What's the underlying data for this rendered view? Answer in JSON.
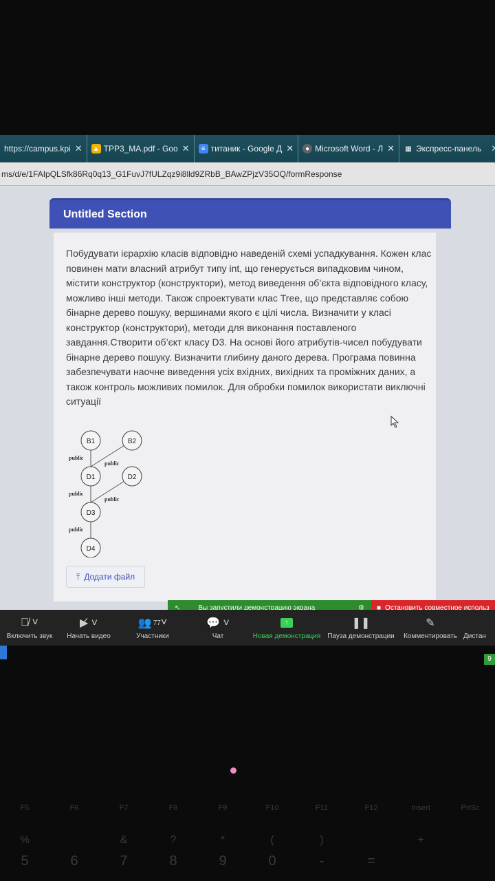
{
  "browser": {
    "tabs": [
      {
        "label": "https://campus.kpi",
        "icon": "site-icon"
      },
      {
        "label": "TPP3_MA.pdf - Goo",
        "icon": "google-drive-icon"
      },
      {
        "label": "титаник - Google Д",
        "icon": "google-docs-icon"
      },
      {
        "label": "Microsoft Word - Л",
        "icon": "chrome-icon"
      },
      {
        "label": "Экспресс-панель",
        "icon": "grid-icon"
      }
    ],
    "url": "ms/d/e/1FAIpQLSfk86Rq0q13_G1FuvJ7fULZqz9i8lld9ZRbB_BAwZPjzV35OQ/formResponse"
  },
  "form": {
    "section_title": "Untitled Section",
    "task_text": "Побудувати ієрархію класів відповідно наведеній схемі успадкування. Кожен клас повинен мати власний атрибут типу int, що генерується випадковим чином, містити конструктор (конструктори), метод виведення об’єкта відповідного класу, можливо інші методи. Також спроектувати клас Tree, що представляє собою бінарне дерево пошуку, вершинами якого є цілі числа. Визначити у класі конструктор (конструктори), методи для виконання поставленого завдання.Створити об’єкт класу D3. На основі його атрибутів-чисел побудувати бінарне дерево пошуку. Визначити глибину даного дерева. Програма повинна забезпечувати наочне виведення усіх вхідних, вихідних та проміжних даних, а також контроль можливих помилок. Для обробки помилок використати виключні ситуації",
    "diagram": {
      "nodes": [
        "B1",
        "B2",
        "D1",
        "D2",
        "D3",
        "D4"
      ],
      "edge_label": "public"
    },
    "add_file_label": "Додати файл"
  },
  "zoom": {
    "share_banner": "Вы запустили демонстрацию экрана",
    "stop_share": "Остановить совместное использ",
    "participants_count": "77",
    "toolbar": [
      {
        "label": "Включить звук",
        "icon": "mic-muted-icon"
      },
      {
        "label": "Начать видео",
        "icon": "video-off-icon"
      },
      {
        "label": "Участники",
        "icon": "participants-icon"
      },
      {
        "label": "Чат",
        "icon": "chat-icon"
      },
      {
        "label": "Новая демонстрация",
        "icon": "share-screen-icon"
      },
      {
        "label": "Пауза демонстрации",
        "icon": "pause-icon"
      },
      {
        "label": "Комментировать",
        "icon": "pencil-icon"
      },
      {
        "label": "Дистан",
        "icon": "remote-icon"
      }
    ],
    "corner_tag": "9"
  },
  "keyboard": {
    "fkeys": [
      "F5",
      "F6",
      "F7",
      "F8",
      "F9",
      "F10",
      "F11",
      "F12",
      "Insert",
      "PrtSc"
    ],
    "symbols": [
      "%",
      "",
      "&",
      "?",
      "*",
      "(",
      ")",
      "",
      "+",
      ""
    ],
    "numbers": [
      "5",
      "6",
      "7",
      "8",
      "9",
      "0",
      "-",
      "=",
      "",
      ""
    ]
  }
}
